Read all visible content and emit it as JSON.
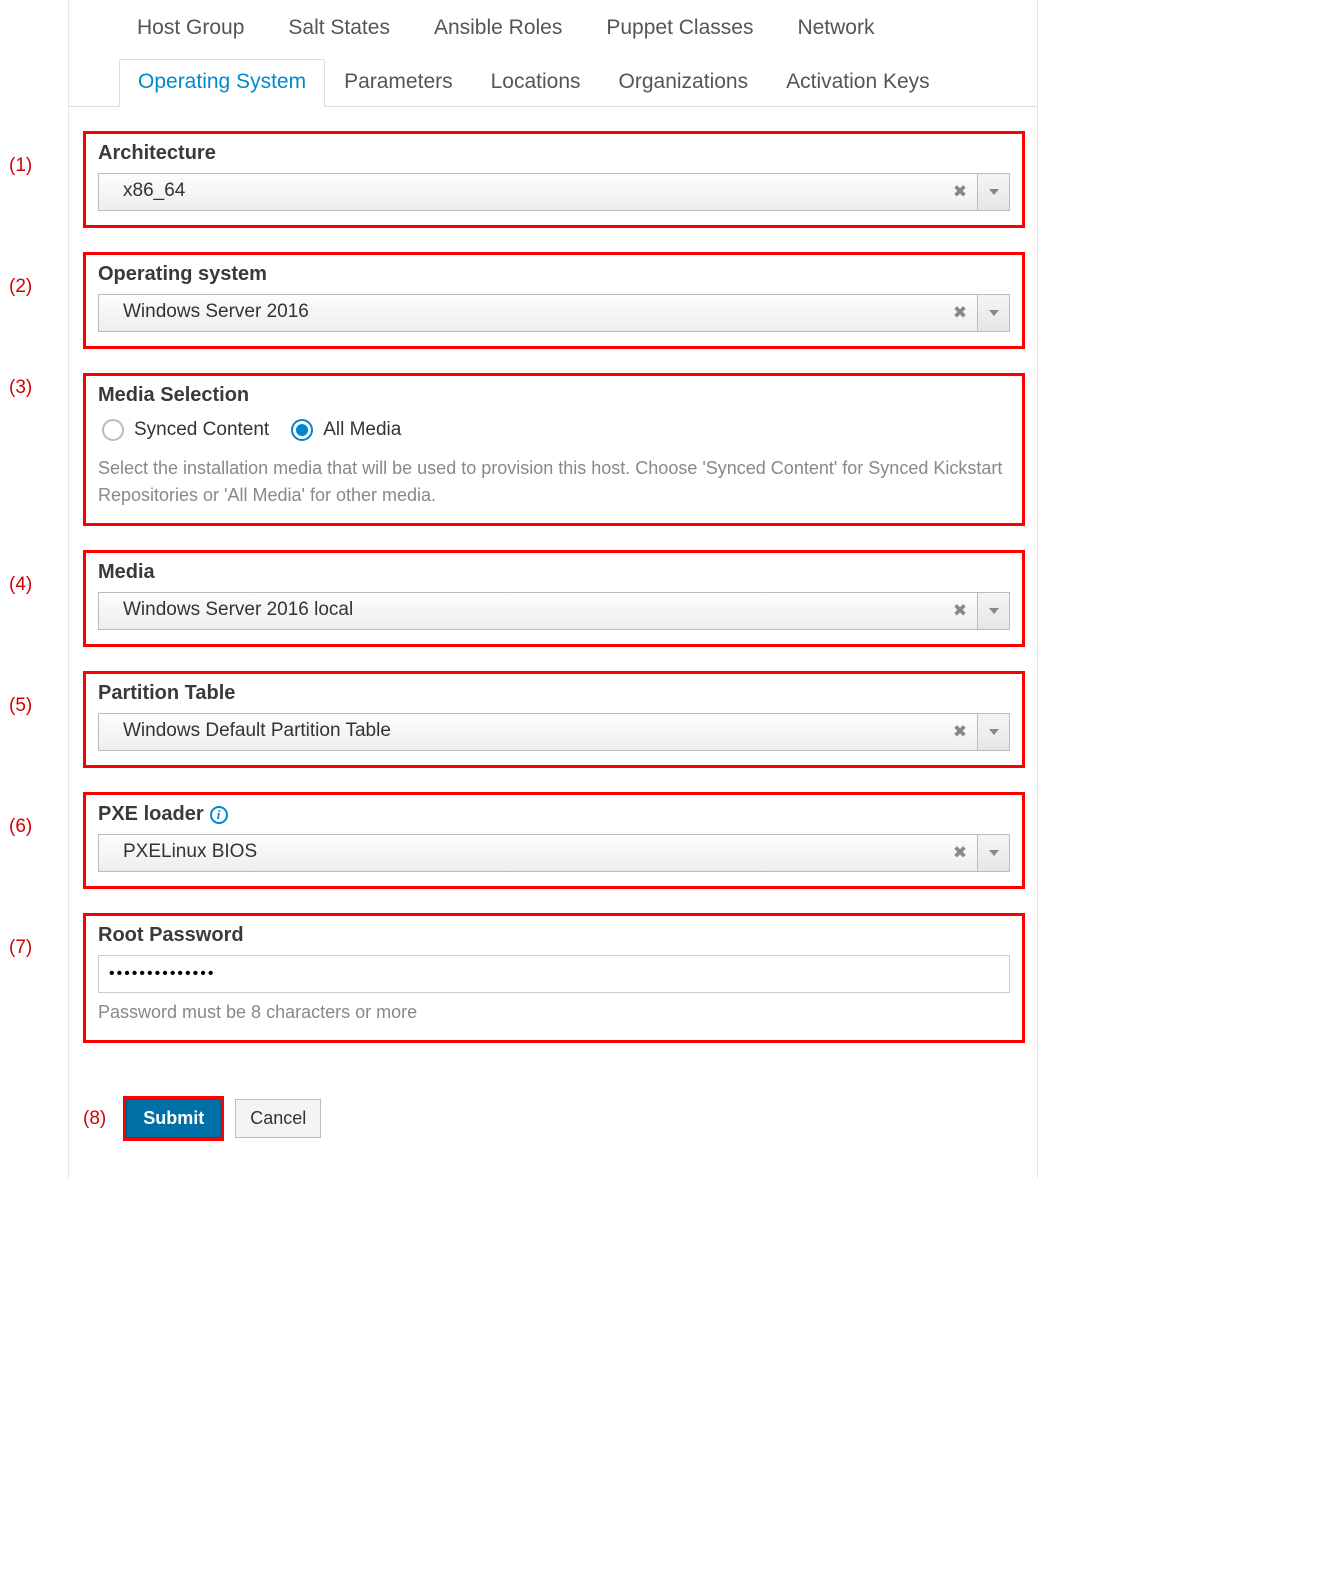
{
  "tabs": {
    "row1": [
      "Host Group",
      "Salt States",
      "Ansible Roles",
      "Puppet Classes",
      "Network"
    ],
    "row2": [
      "Operating System",
      "Parameters",
      "Locations",
      "Organizations",
      "Activation Keys"
    ],
    "active_row2_index": 0
  },
  "annotations": [
    "(1)",
    "(2)",
    "(3)",
    "(4)",
    "(5)",
    "(6)",
    "(7)",
    "(8)"
  ],
  "fields": {
    "architecture": {
      "label": "Architecture",
      "value": "x86_64"
    },
    "os": {
      "label": "Operating system",
      "value": "Windows Server 2016"
    },
    "media_selection": {
      "label": "Media Selection",
      "options": [
        "Synced Content",
        "All Media"
      ],
      "selected": "All Media",
      "help": "Select the installation media that will be used to provision this host. Choose 'Synced Content' for Synced Kickstart Repositories or 'All Media' for other media."
    },
    "media": {
      "label": "Media",
      "value": "Windows Server 2016 local"
    },
    "ptable": {
      "label": "Partition Table",
      "value": "Windows Default Partition Table"
    },
    "pxeloader": {
      "label": "PXE loader",
      "value": "PXELinux BIOS"
    },
    "root_pw": {
      "label": "Root Password",
      "value": "••••••••••••••",
      "help": "Password must be 8 characters or more"
    }
  },
  "buttons": {
    "submit": "Submit",
    "cancel": "Cancel"
  }
}
